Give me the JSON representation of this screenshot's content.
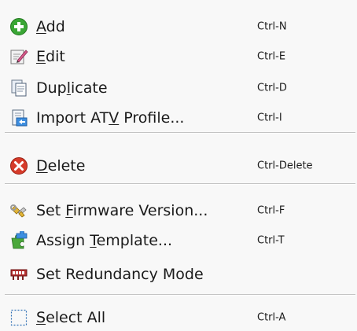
{
  "menu": {
    "items": [
      {
        "pre": "",
        "key": "A",
        "post": "dd",
        "shortcut": "Ctrl-N",
        "icon": "add-icon"
      },
      {
        "pre": "",
        "key": "E",
        "post": "dit",
        "shortcut": "Ctrl-E",
        "icon": "edit-icon"
      },
      {
        "pre": "Dup",
        "key": "l",
        "post": "icate",
        "shortcut": "Ctrl-D",
        "icon": "duplicate-icon"
      },
      {
        "pre": "Import AT",
        "key": "V",
        "post": " Profile...",
        "shortcut": "Ctrl-I",
        "icon": "import-icon"
      },
      {
        "pre": "",
        "key": "D",
        "post": "elete",
        "shortcut": "Ctrl-Delete",
        "icon": "delete-icon"
      },
      {
        "pre": "Set ",
        "key": "F",
        "post": "irmware Version...",
        "shortcut": "Ctrl-F",
        "icon": "firmware-icon"
      },
      {
        "pre": "Assign ",
        "key": "T",
        "post": "emplate...",
        "shortcut": "Ctrl-T",
        "icon": "template-icon"
      },
      {
        "pre": "Set Redundancy Mode",
        "key": "",
        "post": "",
        "shortcut": "",
        "icon": "redundancy-icon"
      },
      {
        "pre": "",
        "key": "S",
        "post": "elect All",
        "shortcut": "Ctrl-A",
        "icon": "select-all-icon"
      }
    ]
  },
  "colors": {
    "add": "#3aa635",
    "delete": "#d63b2a",
    "separator": "#c4c4c4",
    "background": "#f8f8f8"
  }
}
